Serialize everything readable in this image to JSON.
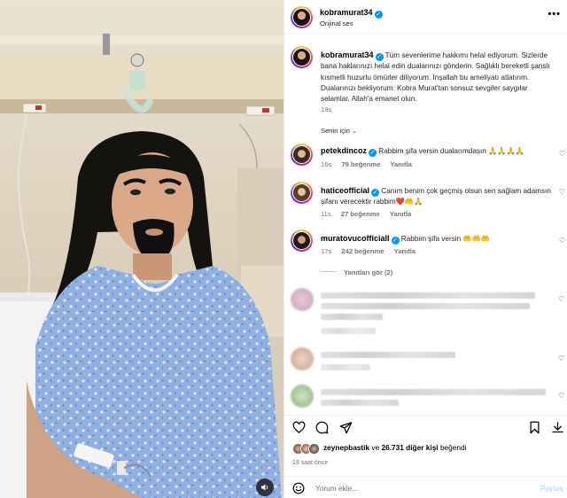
{
  "post": {
    "username": "kobramurat34",
    "audio": "Orijinal ses",
    "more_icon": "more-horizontal-icon"
  },
  "caption": {
    "username": "kobramurat34",
    "text": "Tüm sevenlerime hakkımı helal ediyorum. Sizlerde bana haklarınızı helal edin dualarınızı gönderin. Sağlıklı bereketli şanslı kısmetli huzurlu ömürler diliyorum. İnşallah bu ameliyatı atlatırım. Dualarınızı bekliyorum. Kobra Murat'tan sonsuz sevgiler saygılar selamlar. Allah'a emanet olun.",
    "time": "19s"
  },
  "for_you": "Senin için",
  "comments": [
    {
      "username": "petekdincoz",
      "text": "Rabbim şifa versin dualarımdasın 🙏🙏🙏🙏",
      "time": "16s",
      "likes": "79 beğenme",
      "reply": "Yanıtla"
    },
    {
      "username": "haticeofficial",
      "text": "Canım benim çok geçmiş olsun sen sağlam adamsın şifanı verecektir rabbim❤️🤲🙏",
      "time": "11s",
      "likes": "27 beğenme",
      "reply": "Yanıtla"
    },
    {
      "username": "muratovucofficiall",
      "text": "Rabbim şifa versin 🤲🤲🤲",
      "time": "17s",
      "likes": "242 beğenme",
      "reply": "Yanıtla"
    }
  ],
  "see_replies": "Yanıtları gör (2)",
  "likes": {
    "user": "zeynepbastik",
    "connector": "ve",
    "count": "26.731 diğer kişi",
    "suffix": "beğendi"
  },
  "posted_ago": "19 saat önce",
  "comment_box": {
    "placeholder": "Yorum ekle...",
    "post_label": "Paylaş"
  },
  "colors": {
    "verified": "#0095f6",
    "post_disabled": "#b2dffc",
    "meta_grey": "#737373"
  }
}
